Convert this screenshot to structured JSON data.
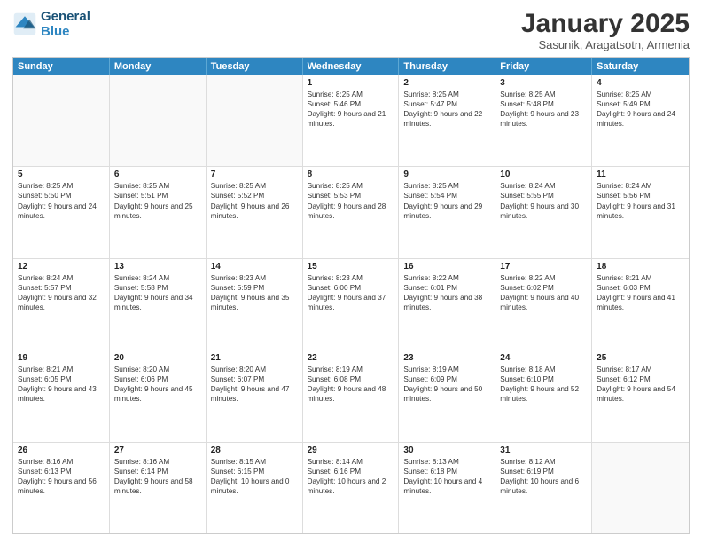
{
  "logo": {
    "line1": "General",
    "line2": "Blue"
  },
  "title": "January 2025",
  "location": "Sasunik, Aragatsotn, Armenia",
  "header_days": [
    "Sunday",
    "Monday",
    "Tuesday",
    "Wednesday",
    "Thursday",
    "Friday",
    "Saturday"
  ],
  "weeks": [
    {
      "cells": [
        {
          "day": "",
          "sunrise": "",
          "sunset": "",
          "daylight": ""
        },
        {
          "day": "",
          "sunrise": "",
          "sunset": "",
          "daylight": ""
        },
        {
          "day": "",
          "sunrise": "",
          "sunset": "",
          "daylight": ""
        },
        {
          "day": "1",
          "sunrise": "Sunrise: 8:25 AM",
          "sunset": "Sunset: 5:46 PM",
          "daylight": "Daylight: 9 hours and 21 minutes."
        },
        {
          "day": "2",
          "sunrise": "Sunrise: 8:25 AM",
          "sunset": "Sunset: 5:47 PM",
          "daylight": "Daylight: 9 hours and 22 minutes."
        },
        {
          "day": "3",
          "sunrise": "Sunrise: 8:25 AM",
          "sunset": "Sunset: 5:48 PM",
          "daylight": "Daylight: 9 hours and 23 minutes."
        },
        {
          "day": "4",
          "sunrise": "Sunrise: 8:25 AM",
          "sunset": "Sunset: 5:49 PM",
          "daylight": "Daylight: 9 hours and 24 minutes."
        }
      ]
    },
    {
      "cells": [
        {
          "day": "5",
          "sunrise": "Sunrise: 8:25 AM",
          "sunset": "Sunset: 5:50 PM",
          "daylight": "Daylight: 9 hours and 24 minutes."
        },
        {
          "day": "6",
          "sunrise": "Sunrise: 8:25 AM",
          "sunset": "Sunset: 5:51 PM",
          "daylight": "Daylight: 9 hours and 25 minutes."
        },
        {
          "day": "7",
          "sunrise": "Sunrise: 8:25 AM",
          "sunset": "Sunset: 5:52 PM",
          "daylight": "Daylight: 9 hours and 26 minutes."
        },
        {
          "day": "8",
          "sunrise": "Sunrise: 8:25 AM",
          "sunset": "Sunset: 5:53 PM",
          "daylight": "Daylight: 9 hours and 28 minutes."
        },
        {
          "day": "9",
          "sunrise": "Sunrise: 8:25 AM",
          "sunset": "Sunset: 5:54 PM",
          "daylight": "Daylight: 9 hours and 29 minutes."
        },
        {
          "day": "10",
          "sunrise": "Sunrise: 8:24 AM",
          "sunset": "Sunset: 5:55 PM",
          "daylight": "Daylight: 9 hours and 30 minutes."
        },
        {
          "day": "11",
          "sunrise": "Sunrise: 8:24 AM",
          "sunset": "Sunset: 5:56 PM",
          "daylight": "Daylight: 9 hours and 31 minutes."
        }
      ]
    },
    {
      "cells": [
        {
          "day": "12",
          "sunrise": "Sunrise: 8:24 AM",
          "sunset": "Sunset: 5:57 PM",
          "daylight": "Daylight: 9 hours and 32 minutes."
        },
        {
          "day": "13",
          "sunrise": "Sunrise: 8:24 AM",
          "sunset": "Sunset: 5:58 PM",
          "daylight": "Daylight: 9 hours and 34 minutes."
        },
        {
          "day": "14",
          "sunrise": "Sunrise: 8:23 AM",
          "sunset": "Sunset: 5:59 PM",
          "daylight": "Daylight: 9 hours and 35 minutes."
        },
        {
          "day": "15",
          "sunrise": "Sunrise: 8:23 AM",
          "sunset": "Sunset: 6:00 PM",
          "daylight": "Daylight: 9 hours and 37 minutes."
        },
        {
          "day": "16",
          "sunrise": "Sunrise: 8:22 AM",
          "sunset": "Sunset: 6:01 PM",
          "daylight": "Daylight: 9 hours and 38 minutes."
        },
        {
          "day": "17",
          "sunrise": "Sunrise: 8:22 AM",
          "sunset": "Sunset: 6:02 PM",
          "daylight": "Daylight: 9 hours and 40 minutes."
        },
        {
          "day": "18",
          "sunrise": "Sunrise: 8:21 AM",
          "sunset": "Sunset: 6:03 PM",
          "daylight": "Daylight: 9 hours and 41 minutes."
        }
      ]
    },
    {
      "cells": [
        {
          "day": "19",
          "sunrise": "Sunrise: 8:21 AM",
          "sunset": "Sunset: 6:05 PM",
          "daylight": "Daylight: 9 hours and 43 minutes."
        },
        {
          "day": "20",
          "sunrise": "Sunrise: 8:20 AM",
          "sunset": "Sunset: 6:06 PM",
          "daylight": "Daylight: 9 hours and 45 minutes."
        },
        {
          "day": "21",
          "sunrise": "Sunrise: 8:20 AM",
          "sunset": "Sunset: 6:07 PM",
          "daylight": "Daylight: 9 hours and 47 minutes."
        },
        {
          "day": "22",
          "sunrise": "Sunrise: 8:19 AM",
          "sunset": "Sunset: 6:08 PM",
          "daylight": "Daylight: 9 hours and 48 minutes."
        },
        {
          "day": "23",
          "sunrise": "Sunrise: 8:19 AM",
          "sunset": "Sunset: 6:09 PM",
          "daylight": "Daylight: 9 hours and 50 minutes."
        },
        {
          "day": "24",
          "sunrise": "Sunrise: 8:18 AM",
          "sunset": "Sunset: 6:10 PM",
          "daylight": "Daylight: 9 hours and 52 minutes."
        },
        {
          "day": "25",
          "sunrise": "Sunrise: 8:17 AM",
          "sunset": "Sunset: 6:12 PM",
          "daylight": "Daylight: 9 hours and 54 minutes."
        }
      ]
    },
    {
      "cells": [
        {
          "day": "26",
          "sunrise": "Sunrise: 8:16 AM",
          "sunset": "Sunset: 6:13 PM",
          "daylight": "Daylight: 9 hours and 56 minutes."
        },
        {
          "day": "27",
          "sunrise": "Sunrise: 8:16 AM",
          "sunset": "Sunset: 6:14 PM",
          "daylight": "Daylight: 9 hours and 58 minutes."
        },
        {
          "day": "28",
          "sunrise": "Sunrise: 8:15 AM",
          "sunset": "Sunset: 6:15 PM",
          "daylight": "Daylight: 10 hours and 0 minutes."
        },
        {
          "day": "29",
          "sunrise": "Sunrise: 8:14 AM",
          "sunset": "Sunset: 6:16 PM",
          "daylight": "Daylight: 10 hours and 2 minutes."
        },
        {
          "day": "30",
          "sunrise": "Sunrise: 8:13 AM",
          "sunset": "Sunset: 6:18 PM",
          "daylight": "Daylight: 10 hours and 4 minutes."
        },
        {
          "day": "31",
          "sunrise": "Sunrise: 8:12 AM",
          "sunset": "Sunset: 6:19 PM",
          "daylight": "Daylight: 10 hours and 6 minutes."
        },
        {
          "day": "",
          "sunrise": "",
          "sunset": "",
          "daylight": ""
        }
      ]
    }
  ]
}
